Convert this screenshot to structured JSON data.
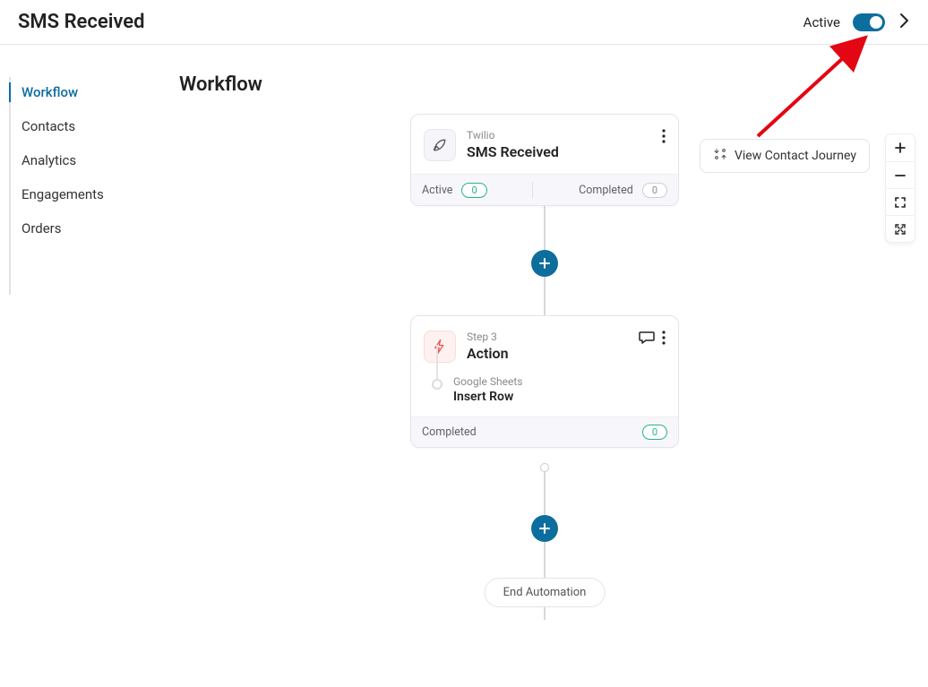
{
  "header": {
    "title": "SMS Received",
    "status_label": "Active"
  },
  "sidebar": {
    "items": [
      {
        "label": "Workflow",
        "active": true
      },
      {
        "label": "Contacts",
        "active": false
      },
      {
        "label": "Analytics",
        "active": false
      },
      {
        "label": "Engagements",
        "active": false
      },
      {
        "label": "Orders",
        "active": false
      }
    ]
  },
  "main": {
    "title": "Workflow",
    "journey_button": "View Contact Journey",
    "end_label": "End Automation"
  },
  "nodes": {
    "trigger": {
      "provider": "Twilio",
      "title": "SMS Received",
      "stats": {
        "active_label": "Active",
        "active_count": "0",
        "completed_label": "Completed",
        "completed_count": "0"
      }
    },
    "action": {
      "step_label": "Step 3",
      "title": "Action",
      "substep_provider": "Google Sheets",
      "substep_title": "Insert Row",
      "stats": {
        "completed_label": "Completed",
        "completed_count": "0"
      }
    }
  }
}
